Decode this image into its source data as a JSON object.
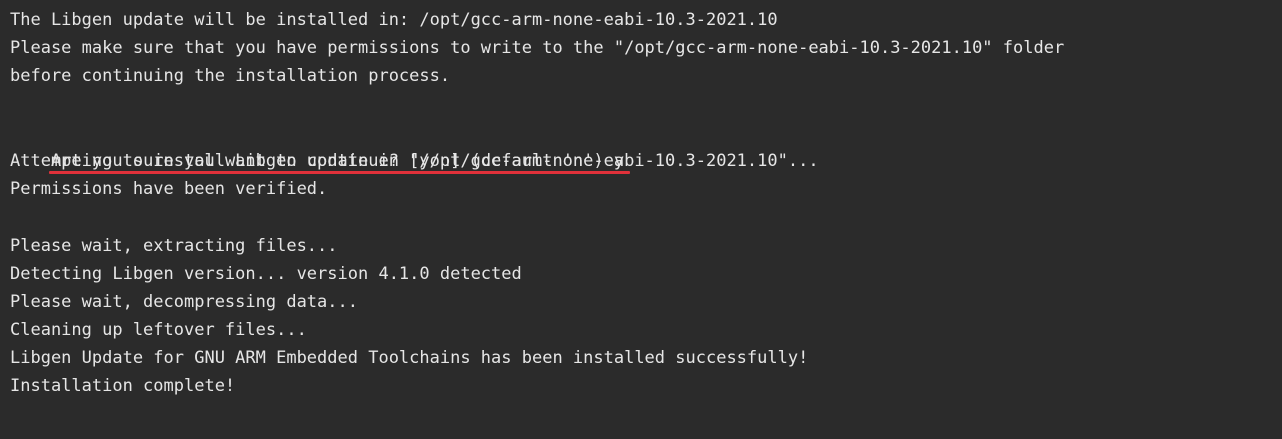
{
  "terminal": {
    "lines": [
      "The Libgen update will be installed in: /opt/gcc-arm-none-eabi-10.3-2021.10",
      "Please make sure that you have permissions to write to the \"/opt/gcc-arm-none-eabi-10.3-2021.10\" folder",
      "before continuing the installation process.",
      "",
      "Are you sure you want to continue? [y/n] (default 'n') y",
      "Attempting to install Libgen update in \"/opt/gcc-arm-none-eabi-10.3-2021.10\"...",
      "Permissions have been verified.",
      "",
      "Please wait, extracting files...",
      "Detecting Libgen version... version 4.1.0 detected",
      "Please wait, decompressing data...",
      "Cleaning up leftover files...",
      "Libgen Update for GNU ARM Embedded Toolchains has been installed successfully!",
      "Installation complete!"
    ],
    "highlighted_line_index": 4,
    "highlight_color": "#e0313a",
    "background_color": "#2b2b2b",
    "text_color": "#e6e6e6"
  }
}
